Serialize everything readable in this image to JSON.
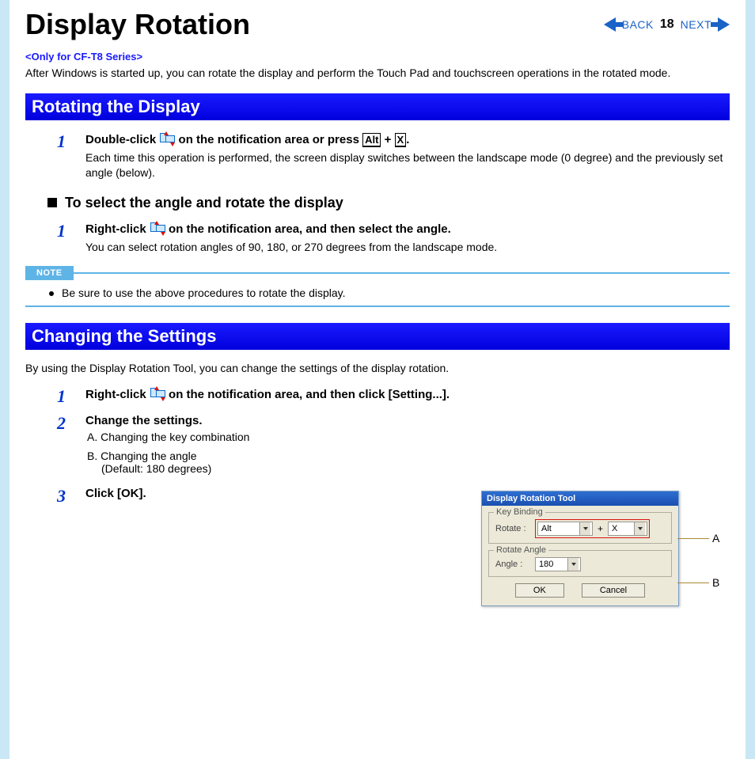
{
  "header": {
    "title": "Display Rotation",
    "back": "BACK",
    "next": "NEXT",
    "page": "18"
  },
  "intro": {
    "only_for": "<Only for CF-T8 Series>",
    "text": "After Windows is started up, you can rotate the display and perform the Touch Pad and touchscreen operations in the rotated mode."
  },
  "section1": {
    "title": "Rotating the Display",
    "step1": {
      "num": "1",
      "pre": "Double-click ",
      "mid": " on the notification area or press ",
      "k1": "Alt",
      "plus": " + ",
      "k2": "X",
      "post": ".",
      "desc": "Each time this operation is performed, the screen display switches between the landscape mode (0 degree) and the previously set angle (below)."
    },
    "subh": "To select the angle and rotate the display",
    "substep": {
      "num": "1",
      "pre": "Right-click ",
      "post": " on the notification area, and then select the angle.",
      "desc": "You can select rotation angles of 90, 180, or 270 degrees from the landscape mode."
    },
    "note_label": "NOTE",
    "note_text": "Be sure to use the above procedures to rotate the display."
  },
  "section2": {
    "title": "Changing the Settings",
    "intro": "By using the Display Rotation Tool, you can change the settings of the display rotation.",
    "step1": {
      "num": "1",
      "pre": "Right-click ",
      "post": " on the notification area, and then click [Setting...]."
    },
    "step2": {
      "num": "2",
      "head": "Change the settings.",
      "a": "A.  Changing the key combination",
      "b": "B.  Changing the angle",
      "b2": "(Default: 180 degrees)"
    },
    "step3": {
      "num": "3",
      "head": "Click [OK]."
    }
  },
  "dialog": {
    "title": "Display Rotation Tool",
    "fs1": "Key Binding",
    "rotate_lbl": "Rotate :",
    "sel1": "Alt",
    "sel2": "X",
    "fs2": "Rotate Angle",
    "angle_lbl": "Angle :",
    "sel3": "180",
    "ok": "OK",
    "cancel": "Cancel",
    "labelA": "A",
    "labelB": "B"
  }
}
